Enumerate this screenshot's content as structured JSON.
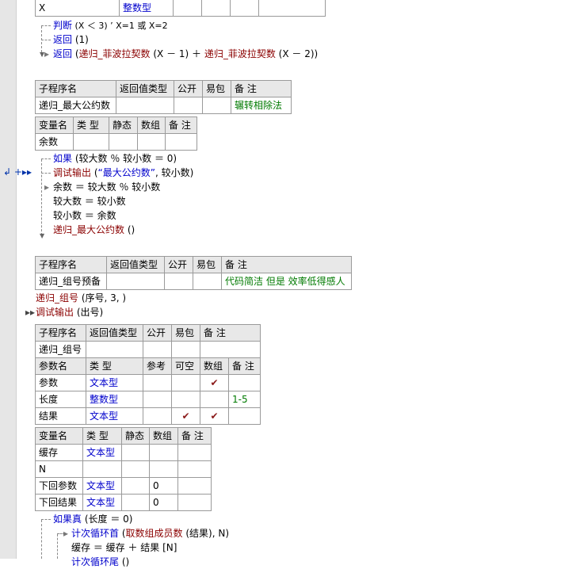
{
  "top_row": {
    "name": "X",
    "type": "整数型"
  },
  "block1": {
    "line1": {
      "kw": "判断",
      "rest": " (X ＜ 3)  ’ X=1 或 X=2"
    },
    "line2": {
      "kw": "返回",
      "rest": " (1)"
    },
    "line3": {
      "kw": "返回",
      "open": " (",
      "fn1": "递归_菲波拉契数",
      "mid": " (X － 1) ＋ ",
      "fn2": "递归_菲波拉契数",
      "end": " (X － 2))"
    }
  },
  "sub_headers": {
    "name": "子程序名",
    "ret": "返回值类型",
    "public": "公开",
    "easy": "易包",
    "note": "备 注"
  },
  "var_headers": {
    "name": "变量名",
    "type": "类 型",
    "static": "静态",
    "array": "数组",
    "note": "备 注"
  },
  "param_headers": {
    "name": "参数名",
    "type": "类 型",
    "ref": "参考",
    "optional": "可空",
    "array": "数组",
    "note": "备 注"
  },
  "sub2": {
    "name": "递归_最大公约数",
    "note": "辗转相除法",
    "var": "余数"
  },
  "block2": {
    "l1": {
      "kw": "如果",
      "rest": " (较大数 ％ 较小数 ＝ 0)"
    },
    "l2": {
      "fn": "调试输出",
      "open": " (",
      "str": "“最大公约数”",
      "rest": ", 较小数)"
    },
    "l3": "余数 ＝ 较大数 ％ 较小数",
    "l4": "较大数 ＝ 较小数",
    "l5": "较小数 ＝ 余数",
    "l6": {
      "fn": "递归_最大公约数",
      "rest": " ()"
    }
  },
  "gutter_marks": "↲ +▸▸",
  "sub3": {
    "name": "递归_组号预备",
    "note": "代码简洁 但是 效率低得感人"
  },
  "block3": {
    "l1": {
      "fn": "递归_组号",
      "rest": " (序号, 3, )"
    },
    "l2": {
      "fn": "调试输出",
      "rest": " (出号)"
    }
  },
  "sub4": {
    "name": "递归_组号",
    "params": [
      {
        "name": "参数",
        "type": "文本型",
        "ref": "",
        "optional": "",
        "array": "✔",
        "note": ""
      },
      {
        "name": "长度",
        "type": "整数型",
        "ref": "",
        "optional": "",
        "array": "",
        "note": "1-5"
      },
      {
        "name": "结果",
        "type": "文本型",
        "ref": "",
        "optional": "✔",
        "array": "✔",
        "note": ""
      }
    ],
    "vars": [
      {
        "name": "缓存",
        "type": "文本型",
        "static": "",
        "array": "",
        "note": ""
      },
      {
        "name": "N",
        "type": "",
        "static": "",
        "array": "",
        "note": ""
      },
      {
        "name": "下回参数",
        "type": "文本型",
        "static": "",
        "array": "0",
        "note": ""
      },
      {
        "name": "下回结果",
        "type": "文本型",
        "static": "",
        "array": "0",
        "note": ""
      }
    ]
  },
  "block4": {
    "l1": {
      "kw": "如果真",
      "rest": " (长度 ＝ 0)"
    },
    "l2": {
      "kw": "计次循环首",
      "open": " (",
      "fn": "取数组成员数",
      "rest": " (结果), N)"
    },
    "l3": "缓存 ＝ 缓存 ＋ 结果 [N]",
    "l4": {
      "kw": "计次循环尾",
      "rest": " ()"
    }
  }
}
